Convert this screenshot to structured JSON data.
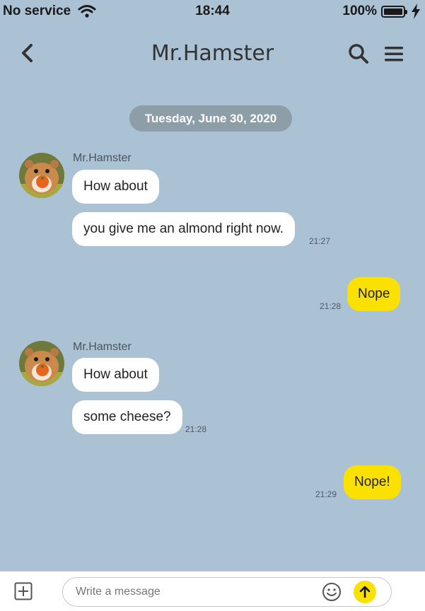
{
  "status_bar": {
    "carrier": "No service",
    "time": "18:44",
    "battery": "100%",
    "icons": [
      "wifi-icon",
      "battery-icon",
      "charging-bolt-icon"
    ]
  },
  "nav": {
    "title": "Mr.Hamster",
    "icons": [
      "back-chevron-icon",
      "search-icon",
      "menu-icon"
    ]
  },
  "date_divider": "Tuesday, June 30, 2020",
  "conversation": {
    "incoming_1": {
      "sender": "Mr.Hamster",
      "messages": [
        "How about",
        "you give me an almond right now."
      ],
      "time": "21:27"
    },
    "outgoing_1": {
      "text": "Nope",
      "time": "21:28"
    },
    "incoming_2": {
      "sender": "Mr.Hamster",
      "messages": [
        "How about",
        "some cheese?"
      ],
      "time": "21:28"
    },
    "outgoing_2": {
      "text": "Nope!",
      "time": "21:29"
    }
  },
  "composer": {
    "placeholder": "Write a message",
    "icons": [
      "add-icon",
      "emoji-icon",
      "send-arrow-icon"
    ]
  },
  "colors": {
    "chat_background": "#abc1d4",
    "outgoing_bubble": "#fae100",
    "incoming_bubble": "#ffffff",
    "date_pill": "#8e9ea9"
  }
}
